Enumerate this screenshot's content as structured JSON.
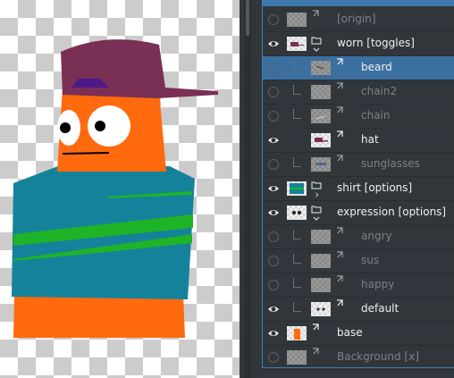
{
  "layers": [
    {
      "name": "[origin]",
      "visible": false,
      "dim": true,
      "kind": "paint",
      "icon": "origin-icon",
      "depth": 0
    },
    {
      "name": "worn [toggles]",
      "visible": true,
      "dim": false,
      "kind": "group",
      "icon": "folder-icon",
      "depth": 0,
      "expanded": true
    },
    {
      "name": "beard",
      "visible": false,
      "dim": false,
      "kind": "paint",
      "depth": 1,
      "selected": true
    },
    {
      "name": "chain2",
      "visible": false,
      "dim": true,
      "kind": "paint",
      "depth": 1
    },
    {
      "name": "chain",
      "visible": false,
      "dim": true,
      "kind": "paint",
      "depth": 1
    },
    {
      "name": "hat",
      "visible": true,
      "dim": false,
      "kind": "paint",
      "depth": 1
    },
    {
      "name": "sunglasses",
      "visible": false,
      "dim": true,
      "kind": "paint",
      "depth": 1
    },
    {
      "name": "shirt [options]",
      "visible": true,
      "dim": false,
      "kind": "group",
      "icon": "folder-icon",
      "depth": 0,
      "expanded": false
    },
    {
      "name": "expression [options]",
      "visible": true,
      "dim": false,
      "kind": "group",
      "icon": "folder-icon",
      "depth": 0,
      "expanded": true
    },
    {
      "name": "angry",
      "visible": false,
      "dim": true,
      "kind": "paint",
      "depth": 1
    },
    {
      "name": "sus",
      "visible": false,
      "dim": true,
      "kind": "paint",
      "depth": 1
    },
    {
      "name": "happy",
      "visible": false,
      "dim": true,
      "kind": "paint",
      "depth": 1
    },
    {
      "name": "default",
      "visible": true,
      "dim": false,
      "kind": "paint",
      "depth": 1
    },
    {
      "name": "base",
      "visible": true,
      "dim": false,
      "kind": "paint",
      "depth": 0
    },
    {
      "name": "Background [x]",
      "visible": false,
      "dim": true,
      "kind": "paint",
      "depth": 0
    }
  ],
  "colors": {
    "accent": "#3d7eb5",
    "selected_row": "#3b6fa0",
    "panel_bg": "#31363b",
    "skin": "#ff6a0e",
    "hat": "#7a2f55",
    "shirt": "#15829b",
    "stripe": "#1fb327"
  }
}
